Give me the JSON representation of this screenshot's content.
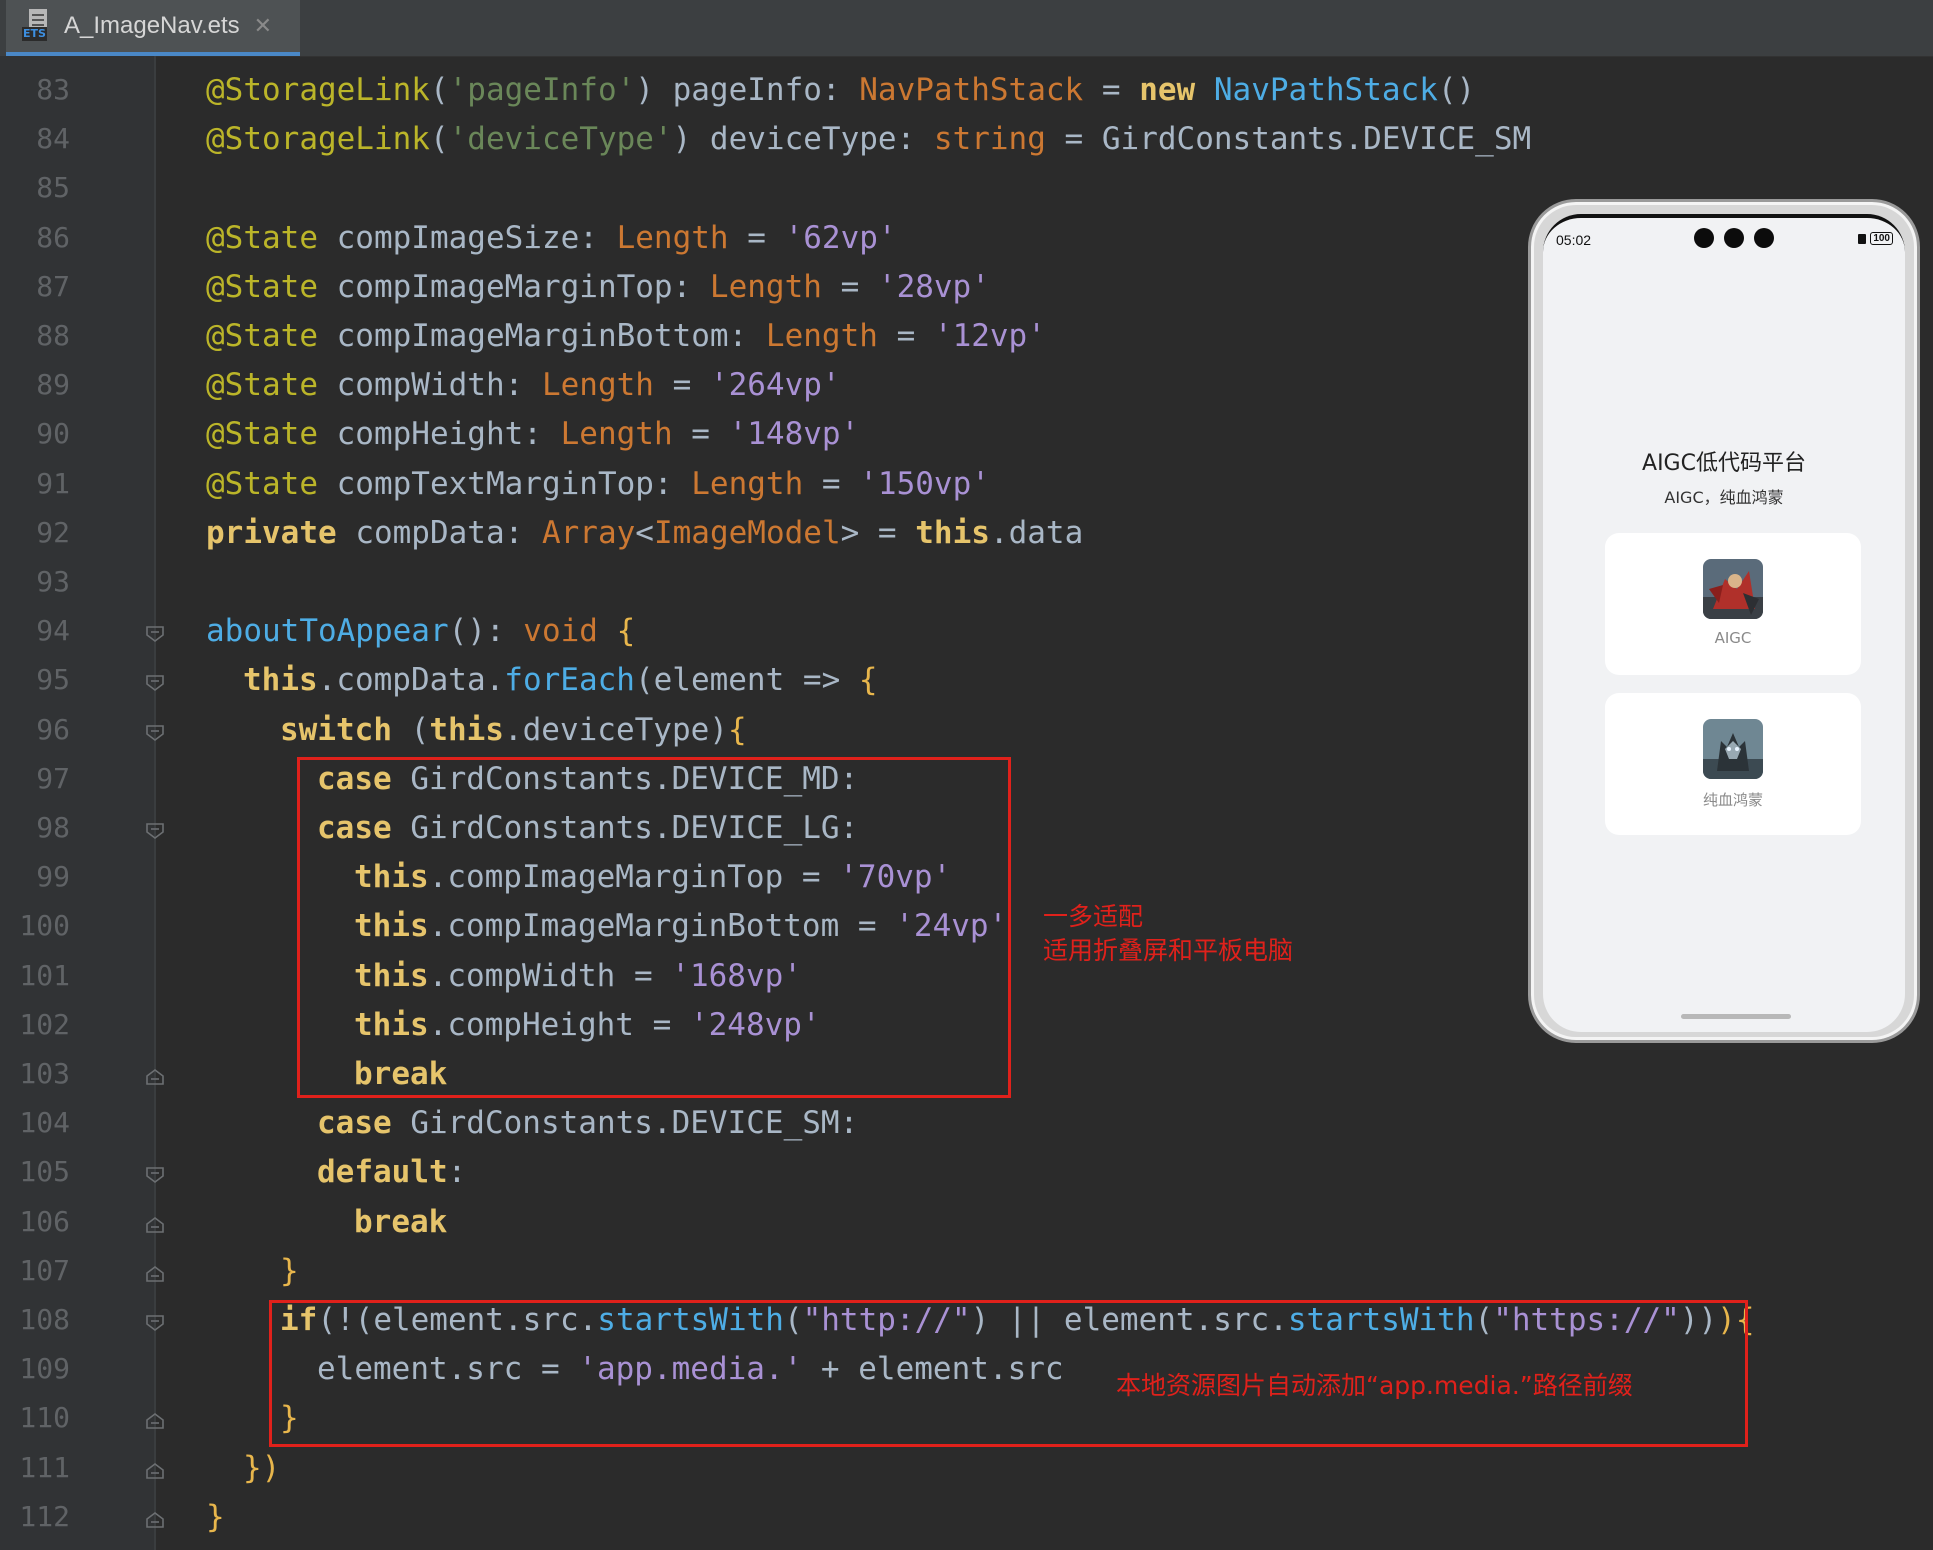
{
  "tab": {
    "filename": "A_ImageNav.ets",
    "icon_badge": "ETS",
    "close_glyph": "✕"
  },
  "code_lines": [
    {
      "n": "83",
      "fold": "",
      "indent": 0,
      "tokens": [
        [
          "an",
          "@StorageLink"
        ],
        [
          "op",
          "("
        ],
        [
          "st",
          "'pageInfo'"
        ],
        [
          "op",
          ") pageInfo: "
        ],
        [
          "ty",
          "NavPathStack"
        ],
        [
          "op",
          " = "
        ],
        [
          "kw",
          "new"
        ],
        [
          "op",
          " "
        ],
        [
          "fn",
          "NavPathStack"
        ],
        [
          "op",
          "()"
        ]
      ]
    },
    {
      "n": "84",
      "fold": "",
      "indent": 0,
      "tokens": [
        [
          "an",
          "@StorageLink"
        ],
        [
          "op",
          "("
        ],
        [
          "st",
          "'deviceType'"
        ],
        [
          "op",
          ") deviceType: "
        ],
        [
          "ty",
          "string"
        ],
        [
          "op",
          " = GirdConstants.DEVICE_SM"
        ]
      ]
    },
    {
      "n": "85",
      "fold": "",
      "indent": 0,
      "tokens": []
    },
    {
      "n": "86",
      "fold": "",
      "indent": 0,
      "tokens": [
        [
          "an",
          "@State"
        ],
        [
          "op",
          " compImageSize: "
        ],
        [
          "ty",
          "Length"
        ],
        [
          "op",
          " = "
        ],
        [
          "str",
          "'62vp'"
        ]
      ]
    },
    {
      "n": "87",
      "fold": "",
      "indent": 0,
      "tokens": [
        [
          "an",
          "@State"
        ],
        [
          "op",
          " compImageMarginTop: "
        ],
        [
          "ty",
          "Length"
        ],
        [
          "op",
          " = "
        ],
        [
          "str",
          "'28vp'"
        ]
      ]
    },
    {
      "n": "88",
      "fold": "",
      "indent": 0,
      "tokens": [
        [
          "an",
          "@State"
        ],
        [
          "op",
          " compImageMarginBottom: "
        ],
        [
          "ty",
          "Length"
        ],
        [
          "op",
          " = "
        ],
        [
          "str",
          "'12vp'"
        ]
      ]
    },
    {
      "n": "89",
      "fold": "",
      "indent": 0,
      "tokens": [
        [
          "an",
          "@State"
        ],
        [
          "op",
          " compWidth: "
        ],
        [
          "ty",
          "Length"
        ],
        [
          "op",
          " = "
        ],
        [
          "str",
          "'264vp'"
        ]
      ]
    },
    {
      "n": "90",
      "fold": "",
      "indent": 0,
      "tokens": [
        [
          "an",
          "@State"
        ],
        [
          "op",
          " compHeight: "
        ],
        [
          "ty",
          "Length"
        ],
        [
          "op",
          " = "
        ],
        [
          "str",
          "'148vp'"
        ]
      ]
    },
    {
      "n": "91",
      "fold": "",
      "indent": 0,
      "tokens": [
        [
          "an",
          "@State"
        ],
        [
          "op",
          " compTextMarginTop: "
        ],
        [
          "ty",
          "Length"
        ],
        [
          "op",
          " = "
        ],
        [
          "str",
          "'150vp'"
        ]
      ]
    },
    {
      "n": "92",
      "fold": "",
      "indent": 0,
      "tokens": [
        [
          "kw",
          "private"
        ],
        [
          "op",
          " compData: "
        ],
        [
          "ty",
          "Array"
        ],
        [
          "op",
          "<"
        ],
        [
          "ty",
          "ImageModel"
        ],
        [
          "op",
          "> = "
        ],
        [
          "kw",
          "this"
        ],
        [
          "op",
          ".data"
        ]
      ]
    },
    {
      "n": "93",
      "fold": "",
      "indent": 0,
      "tokens": []
    },
    {
      "n": "94",
      "fold": "open",
      "indent": 0,
      "tokens": [
        [
          "fn",
          "aboutToAppear"
        ],
        [
          "op",
          "(): "
        ],
        [
          "ty",
          "void"
        ],
        [
          "op",
          " "
        ],
        [
          "pu",
          "{"
        ]
      ]
    },
    {
      "n": "95",
      "fold": "open",
      "indent": 1,
      "tokens": [
        [
          "kw",
          "this"
        ],
        [
          "op",
          ".compData."
        ],
        [
          "fn",
          "forEach"
        ],
        [
          "op",
          "(element => "
        ],
        [
          "pu",
          "{"
        ]
      ]
    },
    {
      "n": "96",
      "fold": "open",
      "indent": 2,
      "tokens": [
        [
          "kw",
          "switch"
        ],
        [
          "op",
          " ("
        ],
        [
          "kw",
          "this"
        ],
        [
          "op",
          ".deviceType)"
        ],
        [
          "pu",
          "{"
        ]
      ]
    },
    {
      "n": "97",
      "fold": "",
      "indent": 3,
      "tokens": [
        [
          "kw",
          "case"
        ],
        [
          "op",
          " GirdConstants.DEVICE_MD:"
        ]
      ]
    },
    {
      "n": "98",
      "fold": "open",
      "indent": 3,
      "tokens": [
        [
          "kw",
          "case"
        ],
        [
          "op",
          " GirdConstants.DEVICE_LG:"
        ]
      ]
    },
    {
      "n": "99",
      "fold": "",
      "indent": 4,
      "tokens": [
        [
          "kw",
          "this"
        ],
        [
          "op",
          ".compImageMarginTop = "
        ],
        [
          "str",
          "'70vp'"
        ]
      ]
    },
    {
      "n": "100",
      "fold": "",
      "indent": 4,
      "tokens": [
        [
          "kw",
          "this"
        ],
        [
          "op",
          ".compImageMarginBottom = "
        ],
        [
          "str",
          "'24vp'"
        ]
      ]
    },
    {
      "n": "101",
      "fold": "",
      "indent": 4,
      "tokens": [
        [
          "kw",
          "this"
        ],
        [
          "op",
          ".compWidth = "
        ],
        [
          "str",
          "'168vp'"
        ]
      ]
    },
    {
      "n": "102",
      "fold": "",
      "indent": 4,
      "tokens": [
        [
          "kw",
          "this"
        ],
        [
          "op",
          ".compHeight = "
        ],
        [
          "str",
          "'248vp'"
        ]
      ]
    },
    {
      "n": "103",
      "fold": "close",
      "indent": 4,
      "tokens": [
        [
          "kw",
          "break"
        ]
      ]
    },
    {
      "n": "104",
      "fold": "",
      "indent": 3,
      "tokens": [
        [
          "kw",
          "case"
        ],
        [
          "op",
          " GirdConstants.DEVICE_SM:"
        ]
      ]
    },
    {
      "n": "105",
      "fold": "open",
      "indent": 3,
      "tokens": [
        [
          "kw",
          "default"
        ],
        [
          "op",
          ":"
        ]
      ]
    },
    {
      "n": "106",
      "fold": "close",
      "indent": 4,
      "tokens": [
        [
          "kw",
          "break"
        ]
      ]
    },
    {
      "n": "107",
      "fold": "close",
      "indent": 2,
      "tokens": [
        [
          "pu",
          "}"
        ]
      ]
    },
    {
      "n": "108",
      "fold": "open",
      "indent": 2,
      "tokens": [
        [
          "kw",
          "if"
        ],
        [
          "op",
          "(!(element.src."
        ],
        [
          "fn",
          "startsWith"
        ],
        [
          "op",
          "("
        ],
        [
          "str",
          "\"http://\""
        ],
        [
          "op",
          ") || element.src."
        ],
        [
          "fn",
          "startsWith"
        ],
        [
          "op",
          "("
        ],
        [
          "str",
          "\"https://\""
        ],
        [
          "op",
          "))"
        ],
        [
          "pu",
          ")"
        ],
        [
          "pu",
          "{"
        ]
      ]
    },
    {
      "n": "109",
      "fold": "",
      "indent": 3,
      "tokens": [
        [
          "op",
          "element.src = "
        ],
        [
          "str",
          "'app.media.'"
        ],
        [
          "op",
          " + element.src"
        ]
      ]
    },
    {
      "n": "110",
      "fold": "close",
      "indent": 2,
      "tokens": [
        [
          "pu",
          "}"
        ]
      ]
    },
    {
      "n": "111",
      "fold": "close",
      "indent": 1,
      "tokens": [
        [
          "pu",
          "})"
        ]
      ]
    },
    {
      "n": "112",
      "fold": "close",
      "indent": 0,
      "tokens": [
        [
          "pu",
          "}"
        ]
      ]
    }
  ],
  "annotations": {
    "note1_line1": "一多适配",
    "note1_line2": "适用折叠屏和平板电脑",
    "note2": "本地资源图片自动添加“app.media.”路径前缀",
    "box_color": "#e0211b"
  },
  "phone": {
    "time": "05:02",
    "battery": "100",
    "title": "AIGC低代码平台",
    "subtitle": "AIGC，纯血鸿蒙",
    "cards": [
      {
        "label": "AIGC",
        "image_icon": "warrior-artwork-thumbnail"
      },
      {
        "label": "纯血鸿蒙",
        "image_icon": "wolf-artwork-thumbnail"
      }
    ]
  }
}
